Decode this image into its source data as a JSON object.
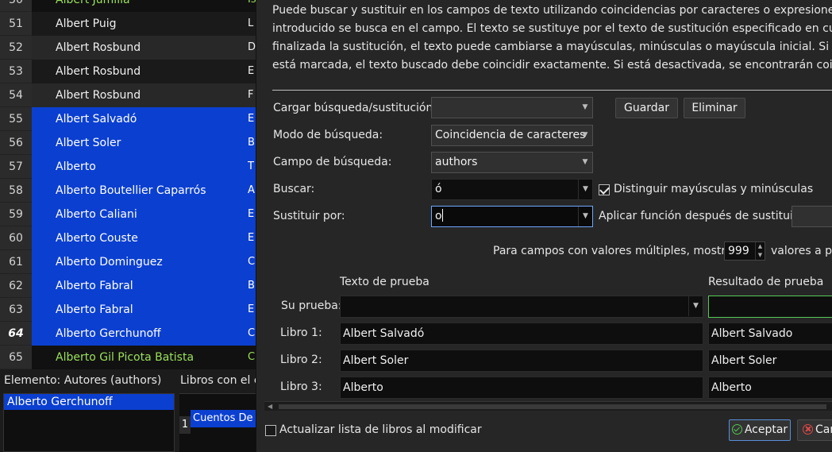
{
  "book_table": {
    "top_partial": {
      "row": "50",
      "name": "Albert Jumilla",
      "extra": "Is"
    },
    "rows": [
      {
        "row": "51",
        "name": "Albert Puig",
        "extra": "L",
        "style": "odd"
      },
      {
        "row": "52",
        "name": "Albert Rosbund",
        "extra": "D",
        "style": "even"
      },
      {
        "row": "53",
        "name": "Albert Rosbund",
        "extra": "E",
        "style": "odd"
      },
      {
        "row": "54",
        "name": "Albert Rosbund",
        "extra": "F",
        "style": "even"
      },
      {
        "row": "55",
        "name": "Albert Salvadó",
        "extra": "E",
        "style": "sel"
      },
      {
        "row": "56",
        "name": "Albert Soler",
        "extra": "B",
        "style": "sel"
      },
      {
        "row": "57",
        "name": "Alberto",
        "extra": "T",
        "style": "sel"
      },
      {
        "row": "58",
        "name": "Alberto Boutellier Caparrós",
        "extra": "A",
        "style": "sel"
      },
      {
        "row": "59",
        "name": "Alberto Caliani",
        "extra": "E",
        "style": "sel"
      },
      {
        "row": "60",
        "name": "Alberto Couste",
        "extra": "E",
        "style": "sel"
      },
      {
        "row": "61",
        "name": "Alberto Dominguez",
        "extra": "C",
        "style": "sel"
      },
      {
        "row": "62",
        "name": "Alberto Fabral",
        "extra": "B",
        "style": "sel"
      },
      {
        "row": "63",
        "name": "Alberto Fabral",
        "extra": "E",
        "style": "sel"
      },
      {
        "row": "64",
        "name": "Alberto Gerchunoff",
        "extra": "C",
        "style": "sel current"
      },
      {
        "row": "65",
        "name": "Alberto Gil Picota Batista",
        "extra": "C",
        "style": "green"
      }
    ]
  },
  "item_pane": {
    "label": "Elemento: Autores (authors)",
    "selected": "Alberto Gerchunoff"
  },
  "books_with": {
    "label": "Libros con el e",
    "row": "1",
    "title": "Cuentos De"
  },
  "dialog": {
    "description": [
      "Puede buscar y sustituir en los campos de texto utilizando coincidencias por caracteres o expresiones regul",
      "introducido se busca en el campo. El texto se sustituye por el texto de sustitución especificado en cualquier",
      "finalizada la sustitución, el texto puede cambiarse a mayúsculas, minúsculas o mayúscula inicial. Si la casill",
      "está marcada, el texto buscado debe coincidir exactamente. Si está desactivada, se encontrarán coincidenc"
    ],
    "load_label": "Cargar búsqueda/sustitución:",
    "load_value": "",
    "save_label": "Guardar",
    "delete_label": "Eliminar",
    "mode_label": "Modo de búsqueda:",
    "mode_value": "Coincidencia de caracteres",
    "field_label": "Campo de búsqueda:",
    "field_value": "authors",
    "search_label": "Buscar:",
    "search_value": "ó",
    "case_label": "Distinguir mayúsculas y minúsculas",
    "case_checked": true,
    "replace_label": "Sustituir por:",
    "replace_value": "o",
    "apply_func_label": "Aplicar función después de sustituir:",
    "multi_label_pre": "Para campos con valores múltiples, mostrar",
    "multi_value": "999",
    "multi_label_post": "valores a pa",
    "test_text_header": "Texto de prueba",
    "test_result_header": "Resultado de prueba",
    "your_test_label": "Su prueba:",
    "your_test_value": "",
    "books": [
      {
        "label": "Libro 1:",
        "text": "Albert Salvadó",
        "result": "Albert Salvado"
      },
      {
        "label": "Libro 2:",
        "text": "Albert Soler",
        "result": "Albert Soler"
      },
      {
        "label": "Libro 3:",
        "text": "Alberto",
        "result": "Alberto"
      }
    ],
    "update_list_label": "Actualizar lista de libros al modificar",
    "update_list_checked": false,
    "ok_label": "Aceptar",
    "cancel_label": "Can"
  },
  "colors": {
    "selection": "#0b3fd0",
    "green_text": "#9be05a",
    "ok_border": "#57c957"
  }
}
